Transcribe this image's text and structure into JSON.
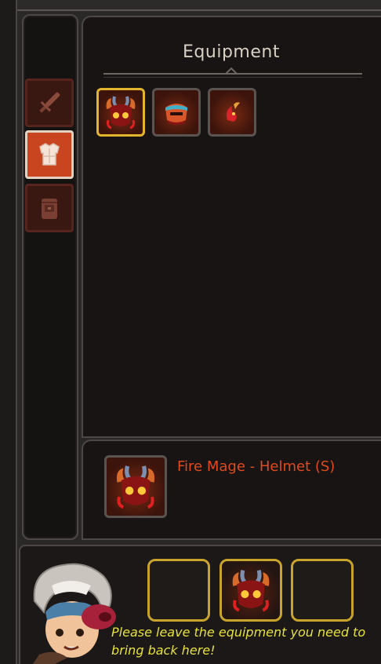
{
  "panel": {
    "title": "Equipment"
  },
  "tabs": [
    {
      "name": "weapon",
      "icon": "sword-icon",
      "active": false
    },
    {
      "name": "armor",
      "icon": "chestplate-icon",
      "active": true
    },
    {
      "name": "inventory",
      "icon": "backpack-icon",
      "active": false
    }
  ],
  "equipment_slots": [
    {
      "item": "fire-mage-helmet-icon",
      "selected": true
    },
    {
      "item": "red-mask-icon",
      "selected": false
    },
    {
      "item": "flame-horn-icon",
      "selected": false
    }
  ],
  "detail": {
    "item_name": "Fire Mage - Helmet (S)",
    "item_icon": "fire-mage-helmet-icon"
  },
  "bring_back": {
    "slots": [
      "",
      "fire-mage-helmet-icon",
      ""
    ],
    "message": "Please leave the equipment you need to bring back here!"
  },
  "colors": {
    "accent_gold": "#e2b52d",
    "item_name": "#e04a1e",
    "message": "#e6e23a",
    "active_tab": "#c9451f"
  }
}
